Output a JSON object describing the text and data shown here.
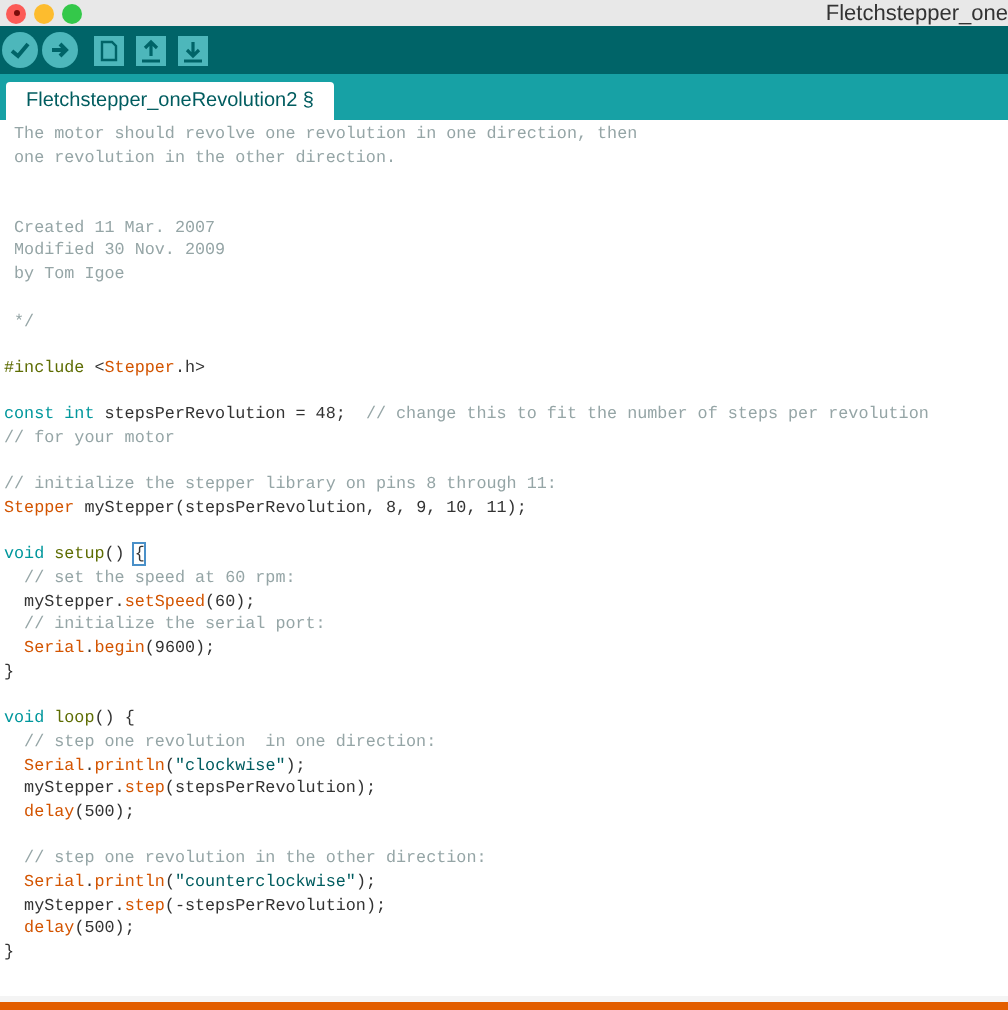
{
  "window": {
    "title": "Fletchstepper_one"
  },
  "tabs": [
    {
      "label": "Fletchstepper_oneRevolution2 §",
      "selected": true
    }
  ],
  "editor": {
    "lines": [
      {
        "kind": "code",
        "segments": [
          {
            "kind": "comment",
            "text": " The motor should revolve one revolution in one direction, then"
          }
        ]
      },
      {
        "kind": "code",
        "segments": [
          {
            "kind": "comment",
            "text": " one revolution in the other direction."
          }
        ]
      },
      {
        "kind": "blank"
      },
      {
        "kind": "blank"
      },
      {
        "kind": "code",
        "segments": [
          {
            "kind": "comment",
            "text": " Created 11 Mar. 2007"
          }
        ]
      },
      {
        "kind": "code",
        "segments": [
          {
            "kind": "comment",
            "text": " Modified 30 Nov. 2009"
          }
        ]
      },
      {
        "kind": "code",
        "segments": [
          {
            "kind": "comment",
            "text": " by Tom Igoe"
          }
        ]
      },
      {
        "kind": "blank"
      },
      {
        "kind": "code",
        "segments": [
          {
            "kind": "comment",
            "text": " */"
          }
        ]
      },
      {
        "kind": "blank"
      },
      {
        "kind": "code",
        "segments": [
          {
            "kind": "preproc",
            "text": "#include"
          },
          {
            "kind": "plain",
            "text": " <"
          },
          {
            "kind": "type",
            "text": "Stepper"
          },
          {
            "kind": "plain",
            "text": ".h>"
          }
        ]
      },
      {
        "kind": "blank"
      },
      {
        "kind": "code",
        "segments": [
          {
            "kind": "keyword",
            "text": "const int"
          },
          {
            "kind": "plain",
            "text": " stepsPerRevolution = 48;  "
          },
          {
            "kind": "comment",
            "text": "// change this to fit the number of steps per revolution"
          }
        ]
      },
      {
        "kind": "code",
        "segments": [
          {
            "kind": "comment",
            "text": "// for your motor"
          }
        ]
      },
      {
        "kind": "blank"
      },
      {
        "kind": "code",
        "segments": [
          {
            "kind": "comment",
            "text": "// initialize the stepper library on pins 8 through 11:"
          }
        ]
      },
      {
        "kind": "code",
        "segments": [
          {
            "kind": "type",
            "text": "Stepper"
          },
          {
            "kind": "plain",
            "text": " myStepper(stepsPerRevolution, 8, 9, 10, 11);"
          }
        ]
      },
      {
        "kind": "blank"
      },
      {
        "kind": "code",
        "segments": [
          {
            "kind": "keyword",
            "text": "void"
          },
          {
            "kind": "preproc",
            "text": " setup"
          },
          {
            "kind": "plain",
            "text": "() "
          },
          {
            "kind": "bracket",
            "text": "{"
          }
        ]
      },
      {
        "kind": "code",
        "segments": [
          {
            "kind": "comment",
            "text": "  // set the speed at 60 rpm:"
          }
        ]
      },
      {
        "kind": "code",
        "segments": [
          {
            "kind": "plain",
            "text": "  myStepper."
          },
          {
            "kind": "type",
            "text": "setSpeed"
          },
          {
            "kind": "plain",
            "text": "(60);"
          }
        ]
      },
      {
        "kind": "code",
        "segments": [
          {
            "kind": "comment",
            "text": "  // initialize the serial port:"
          }
        ]
      },
      {
        "kind": "code",
        "segments": [
          {
            "kind": "type",
            "text": "  Serial"
          },
          {
            "kind": "plain",
            "text": "."
          },
          {
            "kind": "type",
            "text": "begin"
          },
          {
            "kind": "plain",
            "text": "(9600);"
          }
        ]
      },
      {
        "kind": "code",
        "segments": [
          {
            "kind": "plain",
            "text": "}"
          }
        ]
      },
      {
        "kind": "blank"
      },
      {
        "kind": "code",
        "segments": [
          {
            "kind": "keyword",
            "text": "void"
          },
          {
            "kind": "preproc",
            "text": " loop"
          },
          {
            "kind": "plain",
            "text": "() {"
          }
        ]
      },
      {
        "kind": "code",
        "segments": [
          {
            "kind": "comment",
            "text": "  // step one revolution  in one direction:"
          }
        ]
      },
      {
        "kind": "code",
        "segments": [
          {
            "kind": "type",
            "text": "  Serial"
          },
          {
            "kind": "plain",
            "text": "."
          },
          {
            "kind": "type",
            "text": "println"
          },
          {
            "kind": "plain",
            "text": "("
          },
          {
            "kind": "string",
            "text": "\"clockwise\""
          },
          {
            "kind": "plain",
            "text": ");"
          }
        ]
      },
      {
        "kind": "code",
        "segments": [
          {
            "kind": "plain",
            "text": "  myStepper."
          },
          {
            "kind": "type",
            "text": "step"
          },
          {
            "kind": "plain",
            "text": "(stepsPerRevolution);"
          }
        ]
      },
      {
        "kind": "code",
        "segments": [
          {
            "kind": "type",
            "text": "  delay"
          },
          {
            "kind": "plain",
            "text": "(500);"
          }
        ]
      },
      {
        "kind": "blank"
      },
      {
        "kind": "code",
        "segments": [
          {
            "kind": "comment",
            "text": "  // step one revolution in the other direction:"
          }
        ]
      },
      {
        "kind": "code",
        "segments": [
          {
            "kind": "type",
            "text": "  Serial"
          },
          {
            "kind": "plain",
            "text": "."
          },
          {
            "kind": "type",
            "text": "println"
          },
          {
            "kind": "plain",
            "text": "("
          },
          {
            "kind": "string",
            "text": "\"counterclockwise\""
          },
          {
            "kind": "plain",
            "text": ");"
          }
        ]
      },
      {
        "kind": "code",
        "segments": [
          {
            "kind": "plain",
            "text": "  myStepper."
          },
          {
            "kind": "type",
            "text": "step"
          },
          {
            "kind": "plain",
            "text": "(-stepsPerRevolution);"
          }
        ]
      },
      {
        "kind": "code",
        "segments": [
          {
            "kind": "type",
            "text": "  delay"
          },
          {
            "kind": "plain",
            "text": "(500);"
          }
        ]
      },
      {
        "kind": "code",
        "segments": [
          {
            "kind": "plain",
            "text": "}"
          }
        ]
      }
    ]
  }
}
